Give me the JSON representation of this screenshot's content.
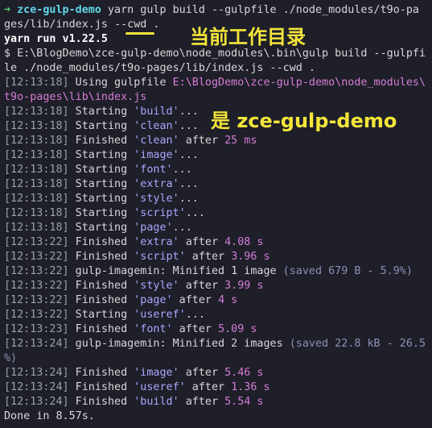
{
  "prompt": {
    "arrow": "➜",
    "dir": "zce-gulp-demo",
    "cmd": "yarn gulp build --gulpfile ./node_modules/t9o-pa",
    "cmd_cont": "ges/lib/index.js ",
    "cwd_flag": "--cwd",
    "cwd_dot": " ."
  },
  "yarn_run": "yarn run v1.22.5",
  "exec": {
    "line1": "$ E:\\BlogDemo\\zce-gulp-demo\\node_modules\\.bin\\gulp build --gulpfi",
    "line2": "le ./node_modules/t9o-pages/lib/index.js --cwd ."
  },
  "using": {
    "ts": "[12:13:18]",
    "label": " Using gulpfile ",
    "path1": "E:\\BlogDemo\\zce-gulp-demo\\node_modules\\",
    "path2": "t9o-pages\\lib\\index.js"
  },
  "annotations": {
    "cwd": "当前工作目录",
    "demo": "是 zce-gulp-demo"
  },
  "log": [
    {
      "ts": "[12:13:18]",
      "verb": " Starting ",
      "task": "'build'",
      "after": "...",
      "time": ""
    },
    {
      "ts": "[12:13:18]",
      "verb": " Starting ",
      "task": "'clean'",
      "after": "...",
      "time": ""
    },
    {
      "ts": "[12:13:18]",
      "verb": " Finished ",
      "task": "'clean'",
      "after": " after ",
      "time": "25 ms"
    },
    {
      "ts": "[12:13:18]",
      "verb": " Starting ",
      "task": "'image'",
      "after": "...",
      "time": ""
    },
    {
      "ts": "[12:13:18]",
      "verb": " Starting ",
      "task": "'font'",
      "after": "...",
      "time": ""
    },
    {
      "ts": "[12:13:18]",
      "verb": " Starting ",
      "task": "'extra'",
      "after": "...",
      "time": ""
    },
    {
      "ts": "[12:13:18]",
      "verb": " Starting ",
      "task": "'style'",
      "after": "...",
      "time": ""
    },
    {
      "ts": "[12:13:18]",
      "verb": " Starting ",
      "task": "'script'",
      "after": "...",
      "time": ""
    },
    {
      "ts": "[12:13:18]",
      "verb": " Starting ",
      "task": "'page'",
      "after": "...",
      "time": ""
    },
    {
      "ts": "[12:13:22]",
      "verb": " Finished ",
      "task": "'extra'",
      "after": " after ",
      "time": "4.08 s"
    },
    {
      "ts": "[12:13:22]",
      "verb": " Finished ",
      "task": "'script'",
      "after": " after ",
      "time": "3.96 s"
    }
  ],
  "imagemin1": {
    "ts": "[12:13:22]",
    "text": " gulp-imagemin: Minified 1 image ",
    "saved": "(saved 679 B - 5.9%)"
  },
  "log2": [
    {
      "ts": "[12:13:22]",
      "verb": " Finished ",
      "task": "'style'",
      "after": " after ",
      "time": "3.99 s"
    },
    {
      "ts": "[12:13:22]",
      "verb": " Finished ",
      "task": "'page'",
      "after": " after ",
      "time": "4 s"
    },
    {
      "ts": "[12:13:22]",
      "verb": " Starting ",
      "task": "'useref'",
      "after": "...",
      "time": ""
    },
    {
      "ts": "[12:13:23]",
      "verb": " Finished ",
      "task": "'font'",
      "after": " after ",
      "time": "5.09 s"
    }
  ],
  "imagemin2": {
    "ts": "[12:13:24]",
    "text": " gulp-imagemin: Minified 2 images ",
    "saved": "(saved 22.8 kB - 26.5",
    "saved2": "%)"
  },
  "log3": [
    {
      "ts": "[12:13:24]",
      "verb": " Finished ",
      "task": "'image'",
      "after": " after ",
      "time": "5.46 s"
    },
    {
      "ts": "[12:13:24]",
      "verb": " Finished ",
      "task": "'useref'",
      "after": " after ",
      "time": "1.36 s"
    },
    {
      "ts": "[12:13:24]",
      "verb": " Finished ",
      "task": "'build'",
      "after": " after ",
      "time": "5.54 s"
    }
  ],
  "done": "Done in 8.57s."
}
